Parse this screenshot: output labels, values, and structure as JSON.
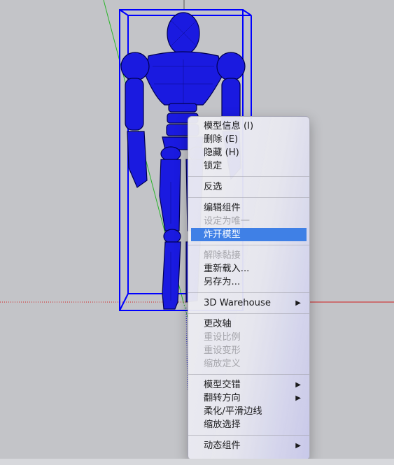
{
  "context_menu": {
    "items": [
      {
        "label": "模型信息 (I)",
        "enabled": true
      },
      {
        "label": "删除 (E)",
        "enabled": true
      },
      {
        "label": "隐藏 (H)",
        "enabled": true
      },
      {
        "label": "锁定",
        "enabled": true
      },
      {
        "label": "反选",
        "enabled": true
      },
      {
        "label": "编辑组件",
        "enabled": true
      },
      {
        "label": "设定为唯一",
        "enabled": false
      },
      {
        "label": "炸开模型",
        "enabled": true,
        "highlighted": true
      },
      {
        "label": "解除黏接",
        "enabled": false
      },
      {
        "label": "重新载入...",
        "enabled": true
      },
      {
        "label": "另存为...",
        "enabled": true
      },
      {
        "label": "3D Warehouse",
        "enabled": true,
        "submenu": true
      },
      {
        "label": "更改轴",
        "enabled": true
      },
      {
        "label": "重设比例",
        "enabled": false
      },
      {
        "label": "重设变形",
        "enabled": false
      },
      {
        "label": "缩放定义",
        "enabled": false
      },
      {
        "label": "模型交错",
        "enabled": true,
        "submenu": true
      },
      {
        "label": "翻转方向",
        "enabled": true,
        "submenu": true
      },
      {
        "label": "柔化/平滑边线",
        "enabled": true
      },
      {
        "label": "缩放选择",
        "enabled": true
      },
      {
        "label": "动态组件",
        "enabled": true,
        "submenu": true
      }
    ],
    "submenu_arrow": "▶"
  },
  "viewport": {
    "background": "#c3c4c8",
    "selection_color": "#0000ff",
    "model_color": "#1a1ae0",
    "axis_red": "#d21c1c",
    "axis_green": "#28b428",
    "axis_blue": "#2828c8"
  }
}
